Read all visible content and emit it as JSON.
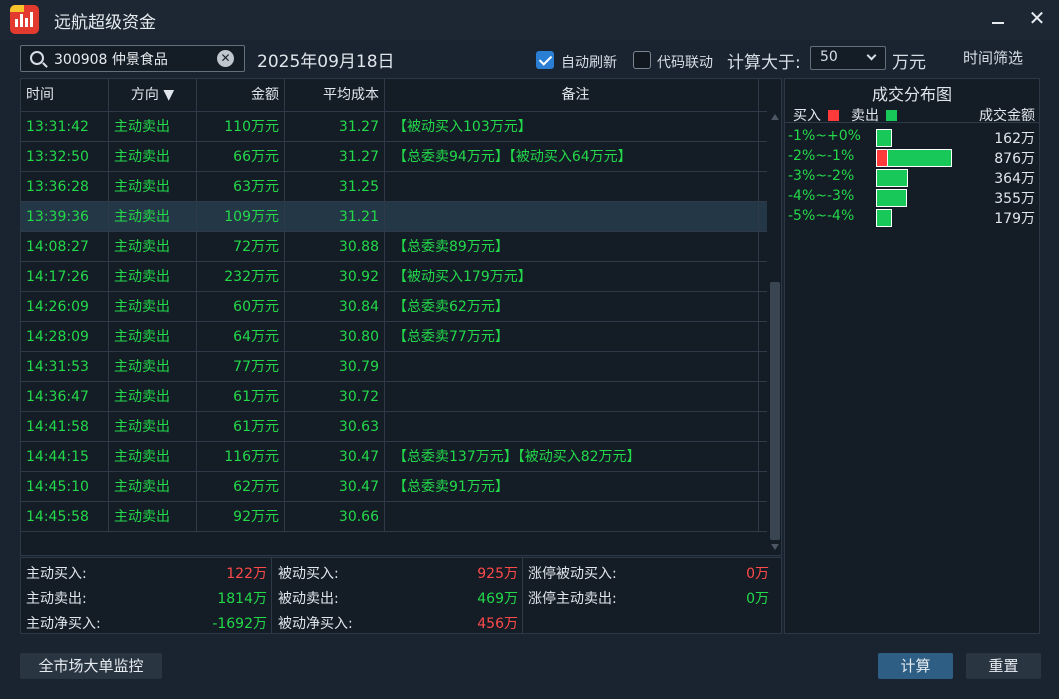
{
  "window": {
    "title": "远航超级资金",
    "close_symbol": "✕"
  },
  "toolbar": {
    "search_value": "300908 仲景食品",
    "clear_symbol": "✕",
    "date": "2025年09月18日",
    "auto_refresh_label": "自动刷新",
    "auto_refresh_checked": true,
    "code_link_label": "代码联动",
    "code_link_checked": false,
    "calc_label": "计算大于:",
    "amount_value": "50",
    "unit_label": "万元",
    "time_filter_label": "时间筛选"
  },
  "table": {
    "headers": {
      "time": "时间",
      "direction": "方向 ▼",
      "amount": "金额",
      "avg_cost": "平均成本",
      "note": "备注"
    },
    "selected_index": 3,
    "rows": [
      {
        "time": "13:31:42",
        "direction": "主动卖出",
        "amount": "110万元",
        "avg_cost": "31.27",
        "note": "【被动买入103万元】"
      },
      {
        "time": "13:32:50",
        "direction": "主动卖出",
        "amount": "66万元",
        "avg_cost": "31.27",
        "note": "【总委卖94万元】【被动买入64万元】"
      },
      {
        "time": "13:36:28",
        "direction": "主动卖出",
        "amount": "63万元",
        "avg_cost": "31.25",
        "note": ""
      },
      {
        "time": "13:39:36",
        "direction": "主动卖出",
        "amount": "109万元",
        "avg_cost": "31.21",
        "note": ""
      },
      {
        "time": "14:08:27",
        "direction": "主动卖出",
        "amount": "72万元",
        "avg_cost": "30.88",
        "note": "【总委卖89万元】"
      },
      {
        "time": "14:17:26",
        "direction": "主动卖出",
        "amount": "232万元",
        "avg_cost": "30.92",
        "note": "【被动买入179万元】"
      },
      {
        "time": "14:26:09",
        "direction": "主动卖出",
        "amount": "60万元",
        "avg_cost": "30.84",
        "note": "【总委卖62万元】"
      },
      {
        "time": "14:28:09",
        "direction": "主动卖出",
        "amount": "64万元",
        "avg_cost": "30.80",
        "note": "【总委卖77万元】"
      },
      {
        "time": "14:31:53",
        "direction": "主动卖出",
        "amount": "77万元",
        "avg_cost": "30.79",
        "note": ""
      },
      {
        "time": "14:36:47",
        "direction": "主动卖出",
        "amount": "61万元",
        "avg_cost": "30.72",
        "note": ""
      },
      {
        "time": "14:41:58",
        "direction": "主动卖出",
        "amount": "61万元",
        "avg_cost": "30.63",
        "note": ""
      },
      {
        "time": "14:44:15",
        "direction": "主动卖出",
        "amount": "116万元",
        "avg_cost": "30.47",
        "note": "【总委卖137万元】【被动买入82万元】"
      },
      {
        "time": "14:45:10",
        "direction": "主动卖出",
        "amount": "62万元",
        "avg_cost": "30.47",
        "note": "【总委卖91万元】"
      },
      {
        "time": "14:45:58",
        "direction": "主动卖出",
        "amount": "92万元",
        "avg_cost": "30.66",
        "note": ""
      }
    ]
  },
  "summary": {
    "active_buy": {
      "label": "主动买入:",
      "value": "122万"
    },
    "active_sell": {
      "label": "主动卖出:",
      "value": "1814万"
    },
    "active_net": {
      "label": "主动净买入:",
      "value": "-1692万"
    },
    "passive_buy": {
      "label": "被动买入:",
      "value": "925万"
    },
    "passive_sell": {
      "label": "被动卖出:",
      "value": "469万"
    },
    "passive_net": {
      "label": "被动净买入:",
      "value": "456万"
    },
    "limit_passive_buy": {
      "label": "涨停被动买入:",
      "value": "0万"
    },
    "limit_active_sell": {
      "label": "涨停主动卖出:",
      "value": "0万"
    }
  },
  "distribution": {
    "title": "成交分布图",
    "buy_label": "买入",
    "sell_label": "卖出",
    "amount_header": "成交金额",
    "colors": {
      "buy": "#ff3a3a",
      "sell": "#18c95a"
    },
    "rows": [
      {
        "range": "-1%~+0%",
        "buy": 0,
        "sell": 162,
        "amount": "162万"
      },
      {
        "range": "-2%~-1%",
        "buy": 122,
        "sell": 754,
        "amount": "876万"
      },
      {
        "range": "-3%~-2%",
        "buy": 0,
        "sell": 364,
        "amount": "364万"
      },
      {
        "range": "-4%~-3%",
        "buy": 0,
        "sell": 355,
        "amount": "355万"
      },
      {
        "range": "-5%~-4%",
        "buy": 0,
        "sell": 179,
        "amount": "179万"
      }
    ]
  },
  "buttons": {
    "market_monitor": "全市场大单监控",
    "calc": "计算",
    "reset": "重置"
  }
}
